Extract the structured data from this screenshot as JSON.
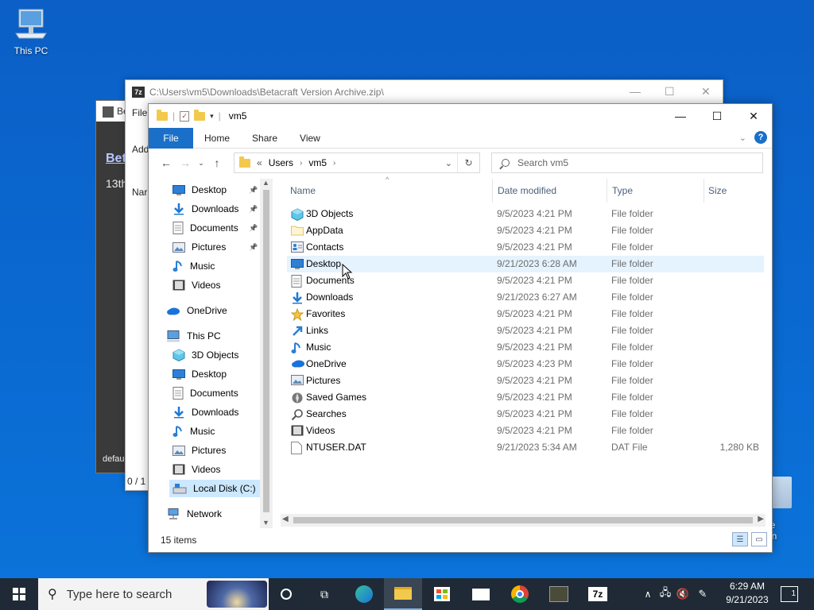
{
  "desktop": {
    "this_pc_label": "This PC",
    "recycle_label": "cle Bin"
  },
  "betacraft_window": {
    "title": "Be",
    "link_text": "Bet",
    "date_text": "13th",
    "bottom_text": "defau"
  },
  "sevenzip_window": {
    "title": "C:\\Users\\vm5\\Downloads\\Betacraft Version Archive.zip\\",
    "menu_file": "File",
    "add_label": "Add",
    "name_col": "Nar",
    "status": "0 / 1"
  },
  "explorer": {
    "title": "vm5",
    "ribbon_tabs": [
      "File",
      "Home",
      "Share",
      "View"
    ],
    "address": {
      "prefix": "«",
      "parts": [
        "Users",
        "vm5"
      ]
    },
    "search_placeholder": "Search vm5",
    "nav_items": [
      {
        "label": "Desktop",
        "icon": "desktop-icon",
        "pinned": true
      },
      {
        "label": "Downloads",
        "icon": "downloads-icon",
        "pinned": true
      },
      {
        "label": "Documents",
        "icon": "documents-icon",
        "pinned": true
      },
      {
        "label": "Pictures",
        "icon": "pictures-icon",
        "pinned": true
      },
      {
        "label": "Music",
        "icon": "music-icon",
        "pinned": false
      },
      {
        "label": "Videos",
        "icon": "videos-icon",
        "pinned": false
      },
      {
        "label": "OneDrive",
        "icon": "onedrive-icon",
        "pinned": false
      },
      {
        "label": "This PC",
        "icon": "computer-icon",
        "pinned": false
      },
      {
        "label": "3D Objects",
        "icon": "3d-objects-icon",
        "pinned": false
      },
      {
        "label": "Desktop",
        "icon": "desktop-icon",
        "pinned": false
      },
      {
        "label": "Documents",
        "icon": "documents-icon",
        "pinned": false
      },
      {
        "label": "Downloads",
        "icon": "downloads-icon",
        "pinned": false
      },
      {
        "label": "Music",
        "icon": "music-icon",
        "pinned": false
      },
      {
        "label": "Pictures",
        "icon": "pictures-icon",
        "pinned": false
      },
      {
        "label": "Videos",
        "icon": "videos-icon",
        "pinned": false
      },
      {
        "label": "Local Disk (C:)",
        "icon": "disk-icon",
        "pinned": false
      },
      {
        "label": "Network",
        "icon": "network-icon",
        "pinned": false
      }
    ],
    "columns": [
      "Name",
      "Date modified",
      "Type",
      "Size"
    ],
    "files": [
      {
        "name": "3D Objects",
        "date": "9/5/2023 4:21 PM",
        "type": "File folder",
        "size": "",
        "icon": "3d-objects-icon"
      },
      {
        "name": "AppData",
        "date": "9/5/2023 4:21 PM",
        "type": "File folder",
        "size": "",
        "icon": "folder-icon"
      },
      {
        "name": "Contacts",
        "date": "9/5/2023 4:21 PM",
        "type": "File folder",
        "size": "",
        "icon": "contacts-icon"
      },
      {
        "name": "Desktop",
        "date": "9/21/2023 6:28 AM",
        "type": "File folder",
        "size": "",
        "icon": "desktop-icon"
      },
      {
        "name": "Documents",
        "date": "9/5/2023 4:21 PM",
        "type": "File folder",
        "size": "",
        "icon": "documents-icon"
      },
      {
        "name": "Downloads",
        "date": "9/21/2023 6:27 AM",
        "type": "File folder",
        "size": "",
        "icon": "downloads-icon"
      },
      {
        "name": "Favorites",
        "date": "9/5/2023 4:21 PM",
        "type": "File folder",
        "size": "",
        "icon": "star-icon"
      },
      {
        "name": "Links",
        "date": "9/5/2023 4:21 PM",
        "type": "File folder",
        "size": "",
        "icon": "links-icon"
      },
      {
        "name": "Music",
        "date": "9/5/2023 4:21 PM",
        "type": "File folder",
        "size": "",
        "icon": "music-icon"
      },
      {
        "name": "OneDrive",
        "date": "9/5/2023 4:23 PM",
        "type": "File folder",
        "size": "",
        "icon": "onedrive-icon"
      },
      {
        "name": "Pictures",
        "date": "9/5/2023 4:21 PM",
        "type": "File folder",
        "size": "",
        "icon": "pictures-icon"
      },
      {
        "name": "Saved Games",
        "date": "9/5/2023 4:21 PM",
        "type": "File folder",
        "size": "",
        "icon": "saved-games-icon"
      },
      {
        "name": "Searches",
        "date": "9/5/2023 4:21 PM",
        "type": "File folder",
        "size": "",
        "icon": "search-icon"
      },
      {
        "name": "Videos",
        "date": "9/5/2023 4:21 PM",
        "type": "File folder",
        "size": "",
        "icon": "videos-icon"
      },
      {
        "name": "NTUSER.DAT",
        "date": "9/21/2023 5:34 AM",
        "type": "DAT File",
        "size": "1,280 KB",
        "icon": "file-icon"
      }
    ],
    "status": "15 items"
  },
  "taskbar": {
    "search_placeholder": "Type here to search",
    "time": "6:29 AM",
    "date": "9/21/2023",
    "notification_count": "1",
    "sevenzip_label": "7z"
  },
  "colors": {
    "accent": "#1a6fc9",
    "selection": "#cce8ff",
    "hover": "#e5f3ff",
    "desktop": "#0a64c8",
    "taskbar": "#1f2a36"
  }
}
